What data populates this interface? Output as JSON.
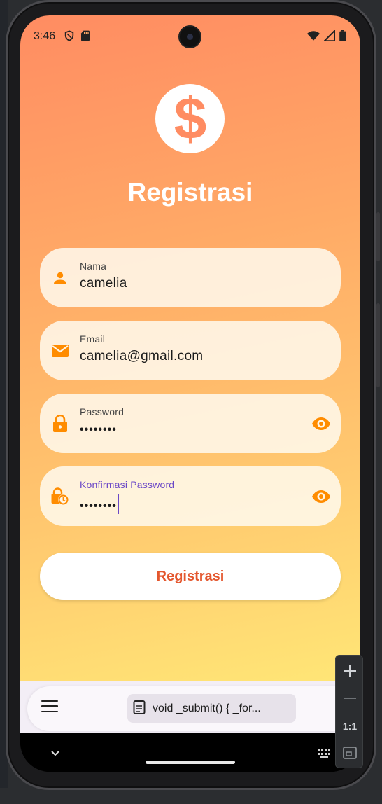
{
  "status_bar": {
    "time": "3:46",
    "left_icons": [
      "shield-icon",
      "sd-card-icon"
    ],
    "right_icons": [
      "wifi-icon",
      "signal-icon",
      "battery-icon"
    ]
  },
  "app": {
    "logo_icon": "dollar-icon",
    "title": "Registrasi",
    "fields": [
      {
        "label": "Nama",
        "value": "camelia",
        "icon": "person-icon"
      },
      {
        "label": "Email",
        "value": "camelia@gmail.com",
        "icon": "email-icon"
      },
      {
        "label": "Password",
        "value": "••••••••",
        "icon": "lock-icon",
        "trailing_icon": "eye-icon"
      },
      {
        "label": "Konfirmasi Password",
        "value": "••••••••",
        "icon": "lock-clock-icon",
        "trailing_icon": "eye-icon",
        "focused": true
      }
    ],
    "submit_label": "Registrasi"
  },
  "bottom_panel": {
    "menu_icon": "menu-icon",
    "clipboard_icon": "clipboard-icon",
    "clipboard_text": "void _submit() {     _for..."
  },
  "nav": {
    "chevron_icon": "chevron-down-icon",
    "keyboard_icon": "keyboard-icon"
  },
  "emulator_toolbar": {
    "zoom_in": "+",
    "zoom_out": "−",
    "actual_size": "1:1"
  },
  "colors": {
    "accent_orange": "#ff8c00",
    "submit_text": "#e4572e",
    "focus_purple": "#6b48c7",
    "gradient_top": "#ff8c62",
    "gradient_bottom": "#ffe676"
  }
}
